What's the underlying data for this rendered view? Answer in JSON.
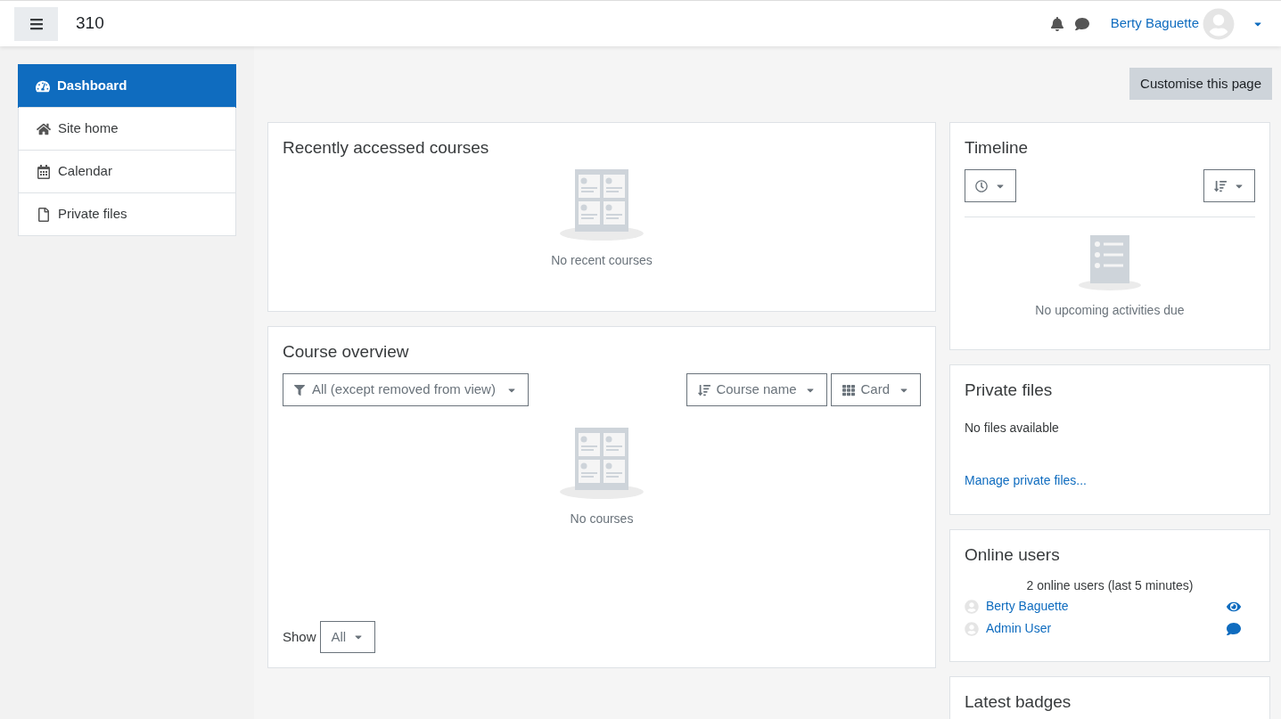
{
  "navbar": {
    "site_name": "310",
    "user_name": "Berty Baguette"
  },
  "sidebar": {
    "items": [
      {
        "label": "Dashboard",
        "kind": "dashboard",
        "selected": true
      },
      {
        "label": "Site home",
        "kind": "home",
        "selected": false
      },
      {
        "label": "Calendar",
        "kind": "calendar",
        "selected": false
      },
      {
        "label": "Private files",
        "kind": "file",
        "selected": false
      }
    ]
  },
  "customise_button": "Customise this page",
  "recent_courses": {
    "title": "Recently accessed courses",
    "empty_text": "No recent courses"
  },
  "course_overview": {
    "title": "Course overview",
    "filter": "All (except removed from view)",
    "sort": "Course name",
    "view": "Card",
    "empty_text": "No courses",
    "show_label": "Show",
    "show_value": "All"
  },
  "timeline": {
    "title": "Timeline",
    "empty_text": "No upcoming activities due"
  },
  "private_files": {
    "title": "Private files",
    "empty_text": "No files available",
    "link": "Manage private files..."
  },
  "online_users": {
    "title": "Online users",
    "summary": "2 online users (last 5 minutes)",
    "users": [
      {
        "name": "Berty Baguette",
        "kind": "view"
      },
      {
        "name": "Admin User",
        "kind": "message"
      }
    ]
  },
  "latest_badges": {
    "title": "Latest badges"
  }
}
